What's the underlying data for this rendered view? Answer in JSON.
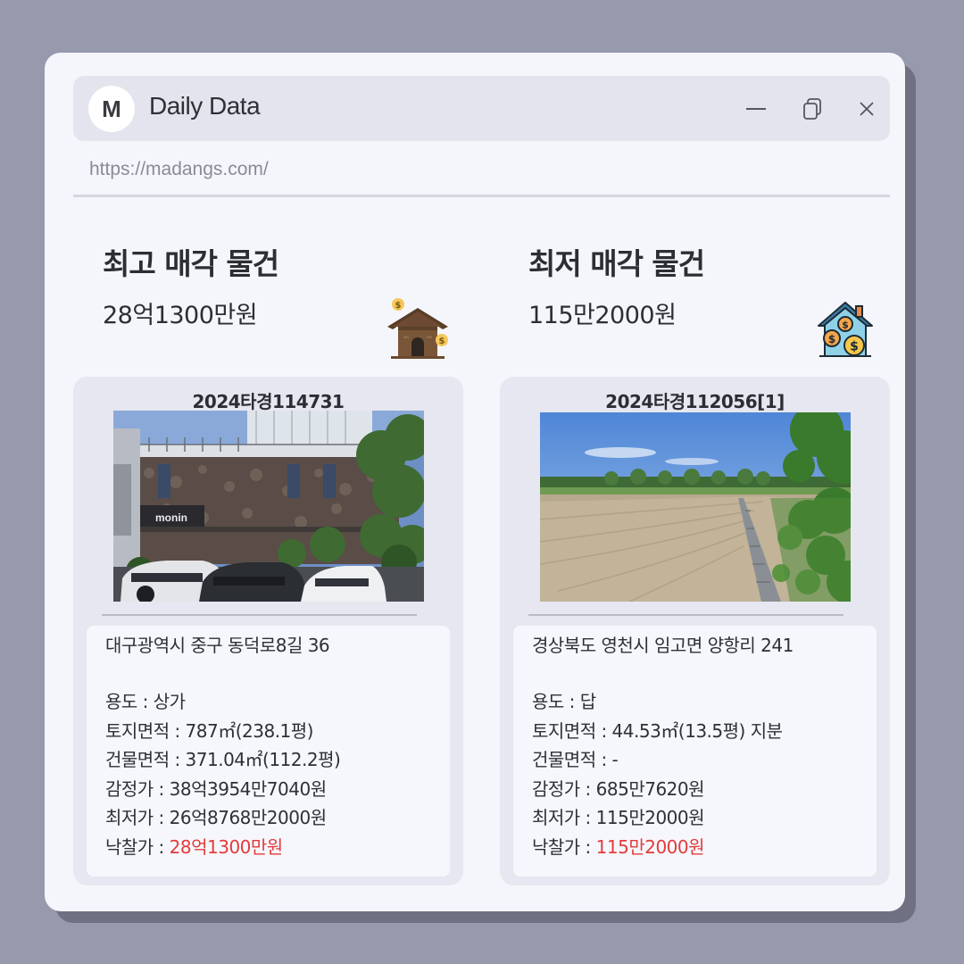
{
  "window": {
    "avatar_letter": "M",
    "title": "Daily Data",
    "url": "https://madangs.com/",
    "controls": [
      "minimize-icon",
      "restore-icon",
      "close-icon"
    ]
  },
  "left": {
    "heading": "최고 매각 물건",
    "price": "28억1300만원",
    "icon": "house-money-icon",
    "case_no": "2024타경114731",
    "photo": "building-photo",
    "address": "대구광역시 중구 동덕로8길 36",
    "usage": "용도 : 상가",
    "land_area": "토지면적 : 787㎡(238.1평)",
    "building_area": "건물면적 : 371.04㎡(112.2평)",
    "appraisal": "감정가 : 38억3954만7040원",
    "minimum": "최저가 : 26억8768만2000원",
    "winning_label": "낙찰가 : ",
    "winning_value": "28억1300만원"
  },
  "right": {
    "heading": "최저 매각 물건",
    "price": "115만2000원",
    "icon": "house-coins-icon",
    "case_no": "2024타경112056[1]",
    "photo": "field-photo",
    "address": "경상북도 영천시 임고면 양항리 241",
    "usage": "용도 : 답",
    "land_area": "토지면적 : 44.53㎡(13.5평) 지분",
    "building_area": "건물면적 : -",
    "appraisal": "감정가 : 685만7620원",
    "minimum": "최저가 : 115만2000원",
    "winning_label": "낙찰가 : ",
    "winning_value": "115만2000원"
  },
  "colors": {
    "accent_red": "#e33b3b",
    "background": "#9799ad",
    "panel": "#f5f6fc"
  }
}
